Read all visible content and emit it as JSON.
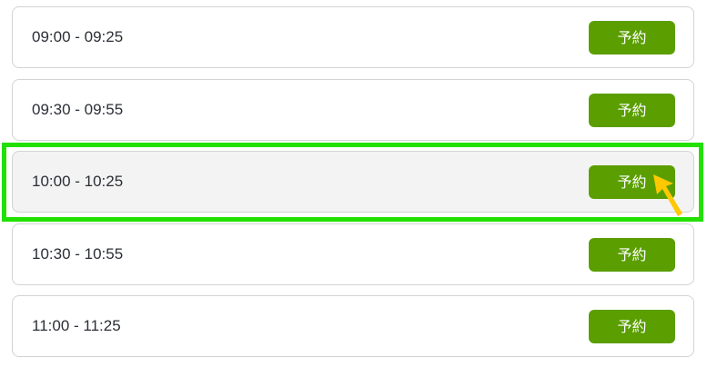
{
  "slots": [
    {
      "time": "09:00 - 09:25",
      "button_label": "予約"
    },
    {
      "time": "09:30 - 09:55",
      "button_label": "予約"
    },
    {
      "time": "10:00 - 10:25",
      "button_label": "予約"
    },
    {
      "time": "10:30 - 10:55",
      "button_label": "予約"
    },
    {
      "time": "11:00 - 11:25",
      "button_label": "予約"
    }
  ],
  "selected_index": 2,
  "colors": {
    "button": "#5a9e00",
    "highlight": "#22e000",
    "cursor": "#ffc800",
    "selected_row": "#f3f3f3"
  },
  "icons": {
    "cursor": "cursor-arrow-icon"
  }
}
